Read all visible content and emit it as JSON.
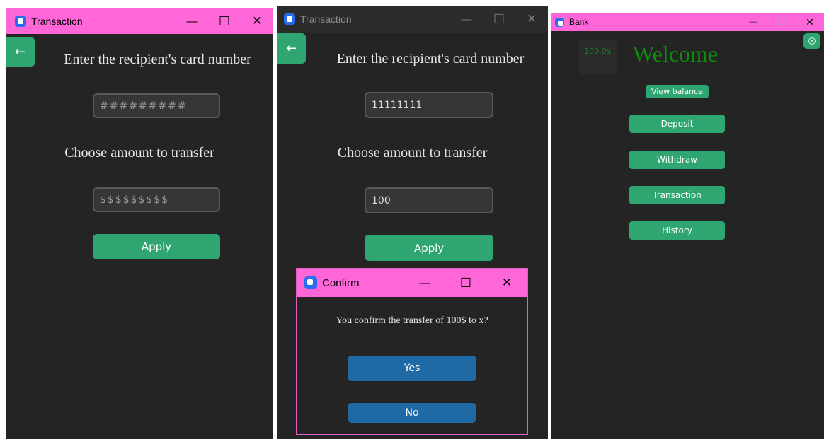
{
  "window1": {
    "title": "Transaction",
    "back_label": "←",
    "card_heading": "Enter the recipient's card number",
    "card_placeholder": "#########",
    "amount_heading": "Choose amount to transfer",
    "amount_placeholder": "$$$$$$$$$",
    "apply_label": "Apply"
  },
  "window2": {
    "title": "Transaction",
    "back_label": "←",
    "card_heading": "Enter the recipient's card number",
    "card_value": "11111111",
    "amount_heading": "Choose amount to transfer",
    "amount_value": "100",
    "apply_label": "Apply"
  },
  "dialog": {
    "title": "Confirm",
    "message": "You confirm the transfer of 100$ to x?",
    "yes_label": "Yes",
    "no_label": "No"
  },
  "bank": {
    "title": "Bank",
    "balance": "100.0$",
    "welcome": "Welcome",
    "view_balance_label": "View balance",
    "menu": [
      {
        "label": "Deposit"
      },
      {
        "label": "Withdraw"
      },
      {
        "label": "Transaction"
      },
      {
        "label": "History"
      }
    ]
  },
  "controls": {
    "minimize": "—",
    "maximize": "☐",
    "close": "✕"
  },
  "colors": {
    "titlebar_active": "#ff66d8",
    "window_bg": "#242424",
    "button_green": "#2fa572",
    "button_blue": "#1f6aa5",
    "welcome_text": "#0f8a0f"
  }
}
